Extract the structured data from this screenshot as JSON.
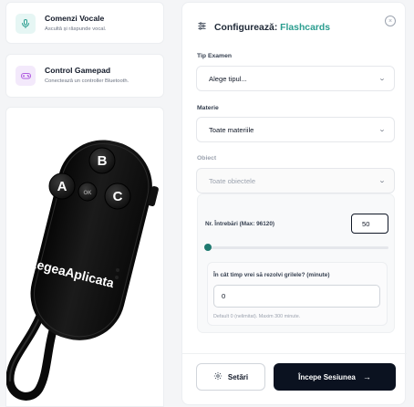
{
  "features": [
    {
      "title": "Comenzi Vocale",
      "subtitle": "Ascultă și răspunde vocal.",
      "icon": "microphone-icon"
    },
    {
      "title": "Control Gamepad",
      "subtitle": "Conectează un controller Bluetooth.",
      "icon": "gamepad-icon"
    }
  ],
  "remote": {
    "buttons": [
      "A",
      "B",
      "C",
      "OK"
    ],
    "brand": "LegeaAplicata"
  },
  "config": {
    "title_prefix": "Configurează:",
    "mode": "Flashcards",
    "exam_type": {
      "label": "Tip Examen",
      "value": "Alege tipul..."
    },
    "subject": {
      "label": "Materie",
      "value": "Toate materiile"
    },
    "object": {
      "label": "Obiect",
      "value": "Toate obiectele",
      "disabled": true
    },
    "questions": {
      "label": "Nr. Întrebări (Max: 96120)",
      "value": "50",
      "max": 96120,
      "slider_fraction": 0.0005
    },
    "time": {
      "label": "În cât timp vrei să rezolvi grilele? (minute)",
      "value": "0",
      "help": "Default 0 (nelimitat). Maxim 300 minute."
    },
    "settings_label": "Setări",
    "start_label": "Începe Sesiunea"
  },
  "colors": {
    "accent": "#2a9d8f",
    "primary_button": "#0b1220"
  }
}
